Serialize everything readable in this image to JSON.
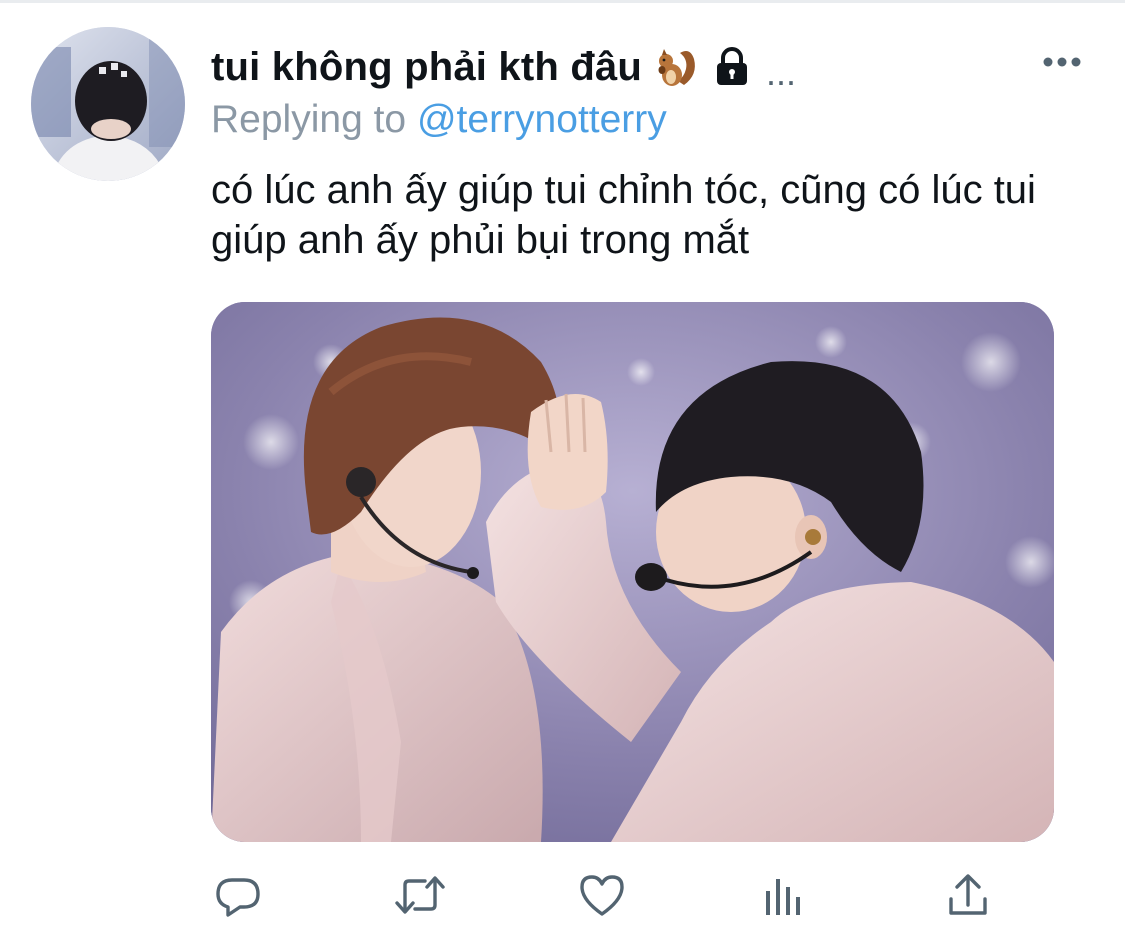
{
  "tweet": {
    "display_name": "tui không phải kth đâu",
    "name_emoji_icon": "squirrel-icon",
    "protected_icon": "lock-icon",
    "truncation": "...",
    "reply_prefix": "Replying to",
    "reply_handle": "@terrynotterry",
    "text": "có lúc anh ấy giúp tui chỉnh tóc, cũng có lúc tui giúp anh ấy phủi bụi trong mắt",
    "media_icon": "photo",
    "actions": [
      "reply-icon",
      "retweet-icon",
      "like-icon",
      "analytics-icon",
      "share-icon"
    ]
  },
  "colors": {
    "text_primary": "#0f1419",
    "text_secondary": "#8b98a5",
    "link": "#4a9ee3",
    "icon": "#536471"
  }
}
